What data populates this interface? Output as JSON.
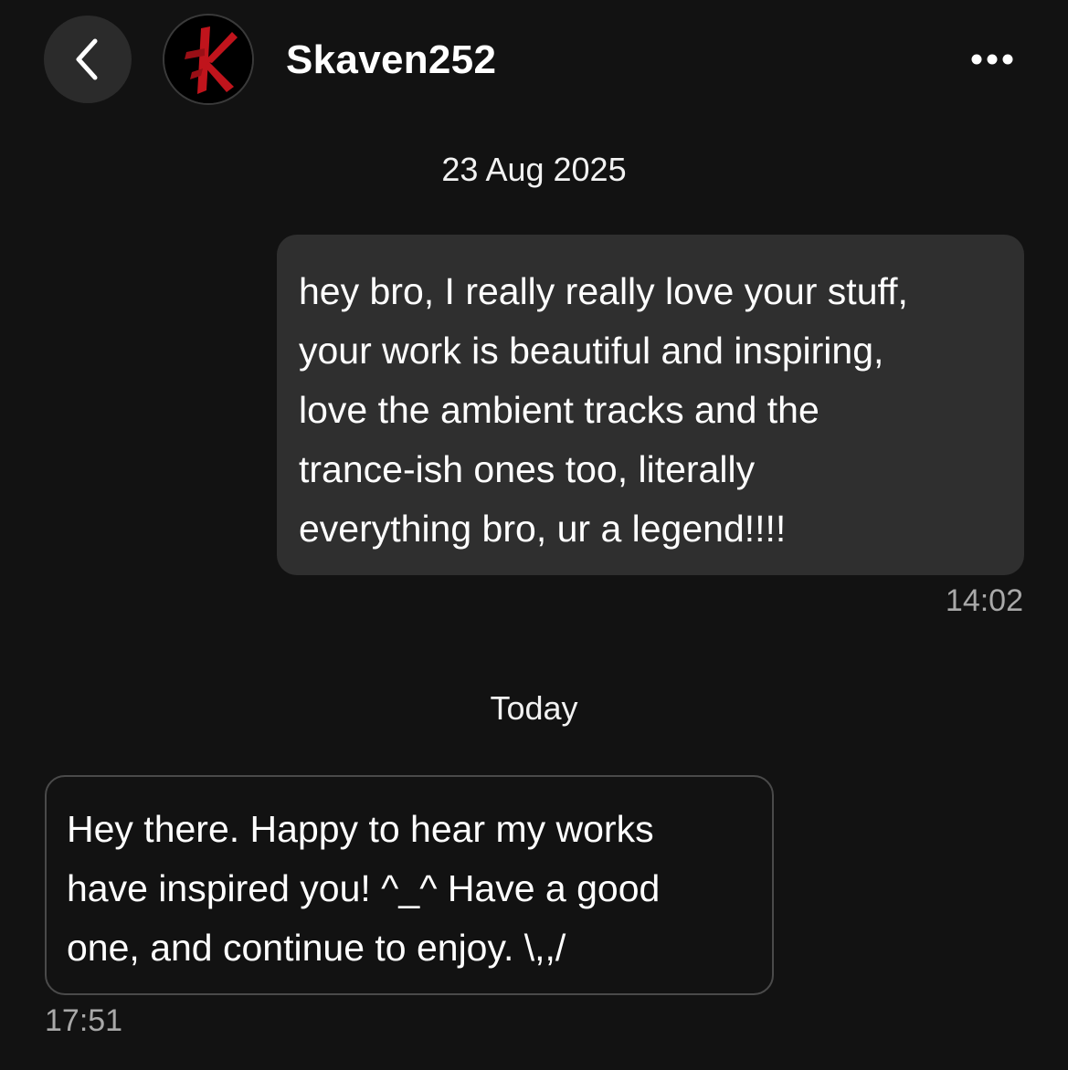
{
  "header": {
    "back_icon": "chevron-left-icon",
    "avatar_icon": "red-k-logo-avatar",
    "username": "Skaven252",
    "more_icon": "more-horizontal-icon"
  },
  "conversation": {
    "groups": [
      {
        "date_label": "23 Aug 2025",
        "messages": [
          {
            "direction": "sent",
            "text": "hey bro, I really really love your stuff,\nyour work is beautiful and inspiring,\nlove the ambient tracks and the\ntrance-ish ones too, literally\neverything bro, ur a legend!!!!",
            "time": "14:02"
          }
        ]
      },
      {
        "date_label": "Today",
        "messages": [
          {
            "direction": "received",
            "text": "Hey there. Happy to hear my works\nhave inspired you! ^_^   Have a good\none, and continue to enjoy. \\,,/",
            "time": "17:51"
          }
        ]
      }
    ]
  },
  "colors": {
    "background": "#121212",
    "sent_bubble": "#2f2f2f",
    "received_border": "#4a4a4a",
    "timestamp": "#a9a9a9",
    "avatar_accent": "#c0141c"
  }
}
